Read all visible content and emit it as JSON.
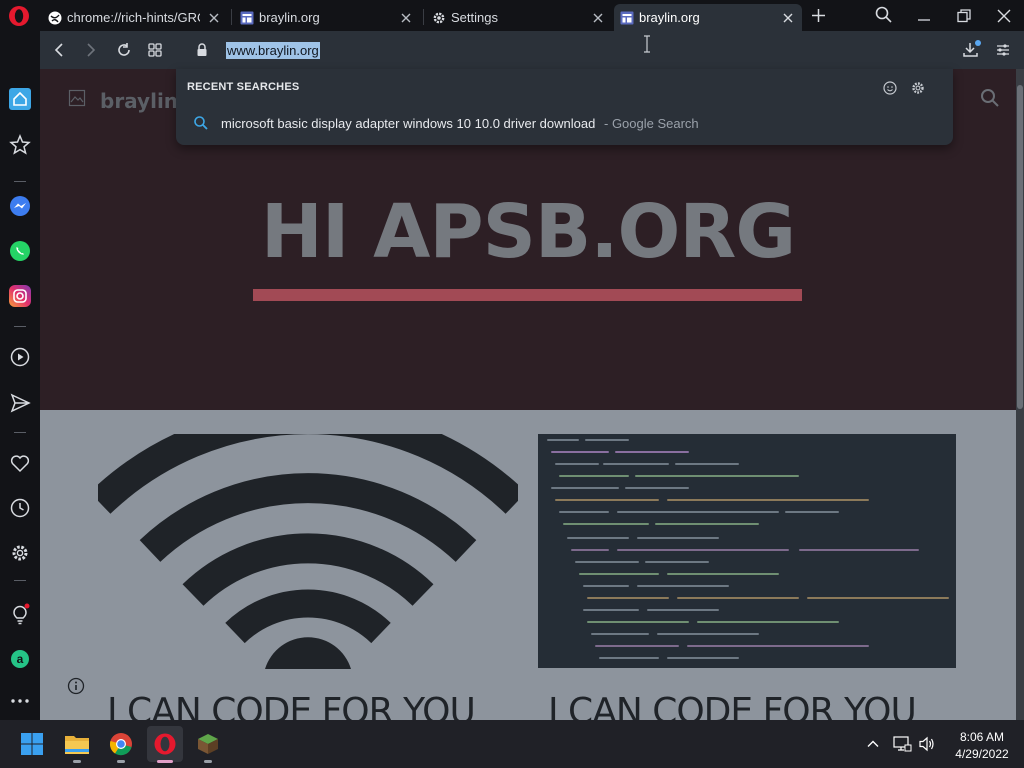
{
  "browser": {
    "tabs": [
      {
        "title": "chrome://rich-hints/GROW",
        "icon": "globe-icon",
        "active": false
      },
      {
        "title": "braylin.org",
        "icon": "site-icon",
        "active": false
      },
      {
        "title": "Settings",
        "icon": "gear-icon",
        "active": false
      },
      {
        "title": "braylin.org",
        "icon": "site-icon",
        "active": true
      }
    ],
    "url": "www.braylin.org"
  },
  "dropdown": {
    "section_label": "RECENT SEARCHES",
    "suggestion": "microsoft basic display adapter windows 10 10.0 driver download",
    "suggestion_source": "- Google Search"
  },
  "page": {
    "logo_text": "braylin.org",
    "hero_title": "HI APSB.ORG",
    "card_left_title": "I CAN CODE FOR YOU",
    "card_right_title": "I CAN CODE FOR YOU"
  },
  "taskbar": {
    "time": "8:06 AM",
    "date": "4/29/2022",
    "apps": [
      "start-icon",
      "file-explorer-icon",
      "chrome-icon",
      "opera-icon",
      "minecraft-icon"
    ]
  },
  "colors": {
    "accent_opera": "#e5192e",
    "hero_bar": "#a24a55",
    "selection": "#9fc3e7"
  }
}
